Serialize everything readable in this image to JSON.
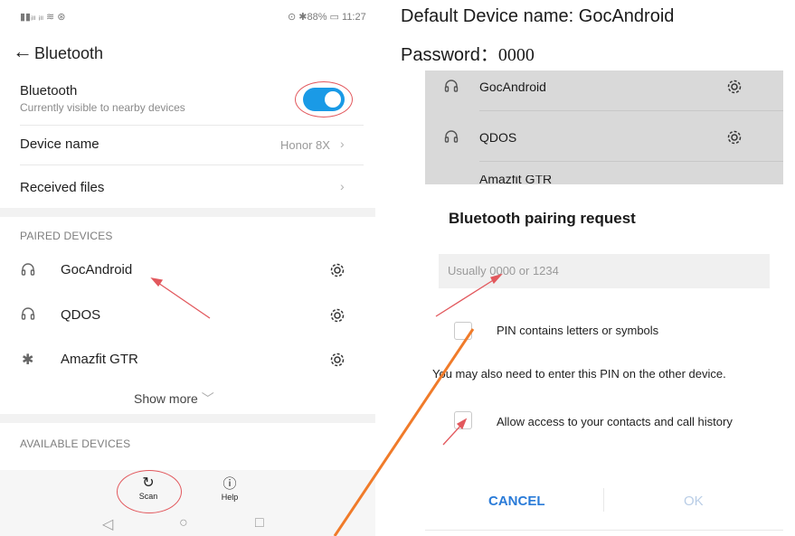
{
  "left": {
    "status_left": "▮▮ᵢₗₗ ᵢₗₗ ≋ ⊛",
    "status_right": "⊙ ✱88% ▭ 11:27",
    "title": "Bluetooth",
    "bluetooth_row": {
      "label": "Bluetooth",
      "sub": "Currently visible to nearby devices",
      "toggle_on": true
    },
    "device_name": {
      "label": "Device name",
      "value": "Honor 8X"
    },
    "received_files": {
      "label": "Received files"
    },
    "paired_header": "PAIRED DEVICES",
    "paired": [
      {
        "name": "GocAndroid",
        "icon": "headphones-icon"
      },
      {
        "name": "QDOS",
        "icon": "headphones-icon"
      },
      {
        "name": "Amazfit GTR",
        "icon": "bluetooth-icon"
      }
    ],
    "show_more": "Show more",
    "available_header": "AVAILABLE DEVICES",
    "bottom": {
      "scan": "Scan",
      "help": "Help"
    }
  },
  "right": {
    "caption_name_label": "Default Device name:",
    "caption_name_value": "GocAndroid",
    "caption_pw_label": "Password：",
    "caption_pw_value": "0000",
    "background_list": [
      "GocAndroid",
      "QDOS",
      "Amazfit GTR"
    ],
    "dialog": {
      "title": "Bluetooth pairing request",
      "pin_placeholder": "Usually 0000 or 1234",
      "pin_letters": "PIN contains letters or symbols",
      "other_device_note": "You may also need to enter this PIN on the other device.",
      "contacts_access": "Allow access to your contacts and call history",
      "cancel": "CANCEL",
      "ok": "OK"
    }
  },
  "colors": {
    "accent": "#1a9ae6",
    "annotation_red": "#e2585d",
    "annotation_orange": "#f07b2a"
  }
}
